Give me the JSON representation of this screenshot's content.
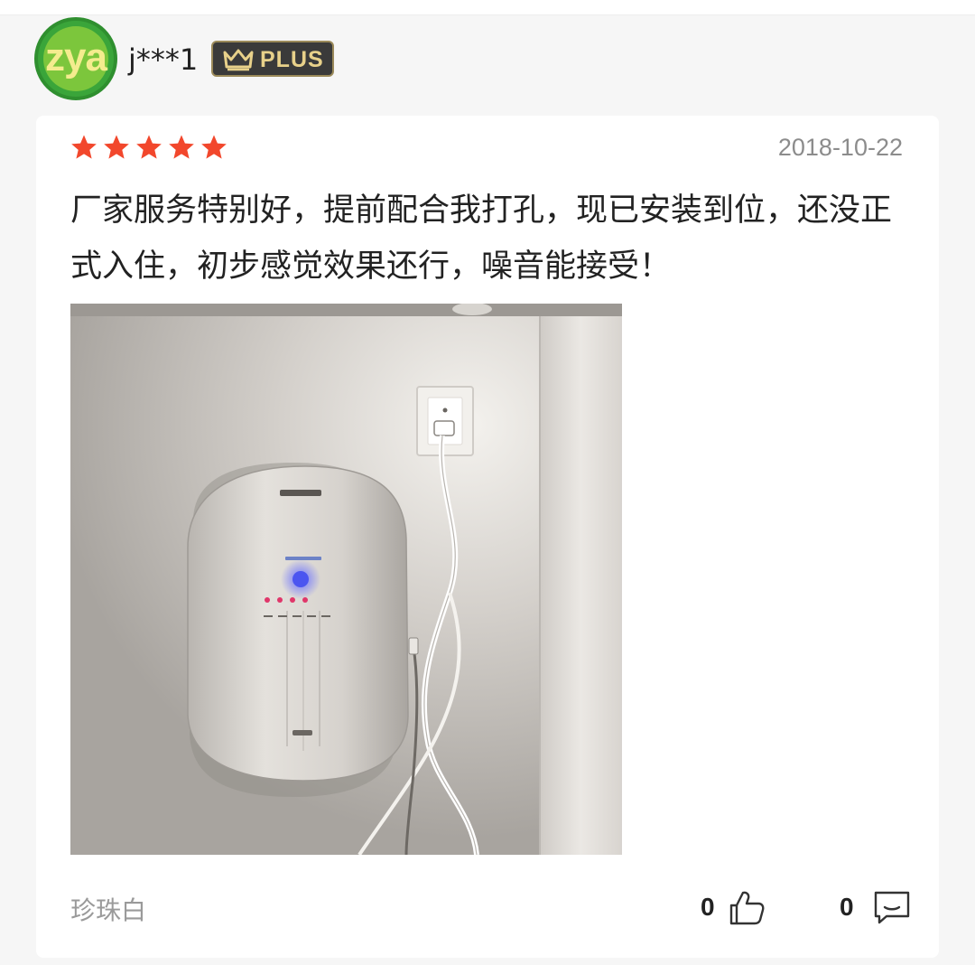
{
  "user": {
    "avatar_text": "zya",
    "name": "j***1",
    "badge_label": "PLUS"
  },
  "review": {
    "rating": 5,
    "date": "2018-10-22",
    "text": "厂家服务特别好，提前配合我打孔，现已安装到位，还没正式入住，初步感觉效果还行，噪音能接受！",
    "variant": "珍珠白",
    "likes": "0",
    "comments": "0"
  },
  "colors": {
    "star": "#f2472c",
    "badge_bg": "#3a3a3a",
    "badge_text": "#e8d18a",
    "avatar_bg": "#7cc63c"
  },
  "icons": {
    "crown": "crown-icon",
    "star": "star-icon",
    "like": "thumbs-up-icon",
    "comment": "comment-icon"
  }
}
